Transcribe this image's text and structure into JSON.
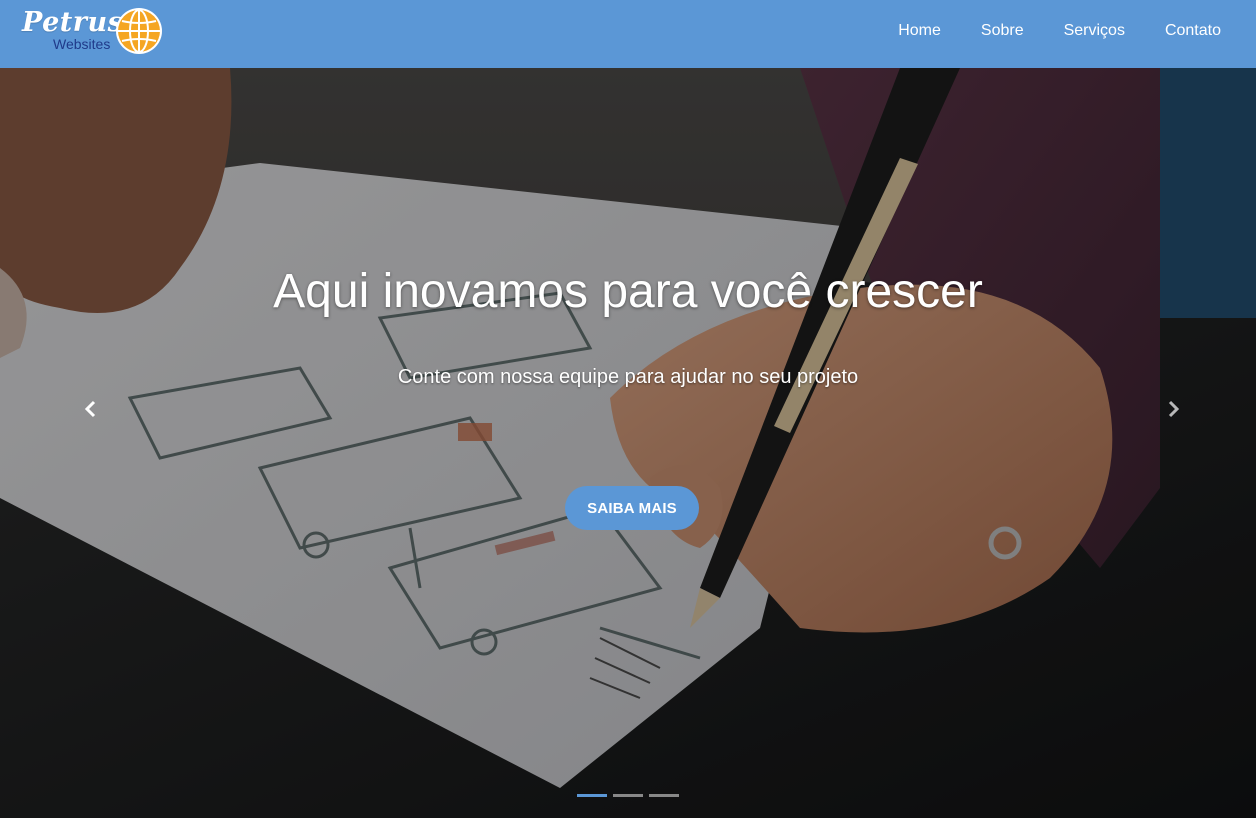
{
  "brand": {
    "name": "Petrus",
    "subtitle": "Websites",
    "globe_icon": "globe-icon",
    "globe_color": "#f5a623",
    "subtitle_color": "#1f3a8a"
  },
  "nav": {
    "items": [
      {
        "label": "Home"
      },
      {
        "label": "Sobre"
      },
      {
        "label": "Serviços"
      },
      {
        "label": "Contato"
      }
    ]
  },
  "hero": {
    "title": "Aqui inovamos para você crescer",
    "subtitle": "Conte com nossa equipe para ajudar no seu projeto",
    "cta_label": "SAIBA MAIS",
    "prev_icon": "chevron-left-icon",
    "next_icon": "chevron-right-icon",
    "slide_count": 3,
    "active_slide": 1
  },
  "colors": {
    "primary": "#5b97d6",
    "text_light": "#ffffff"
  }
}
